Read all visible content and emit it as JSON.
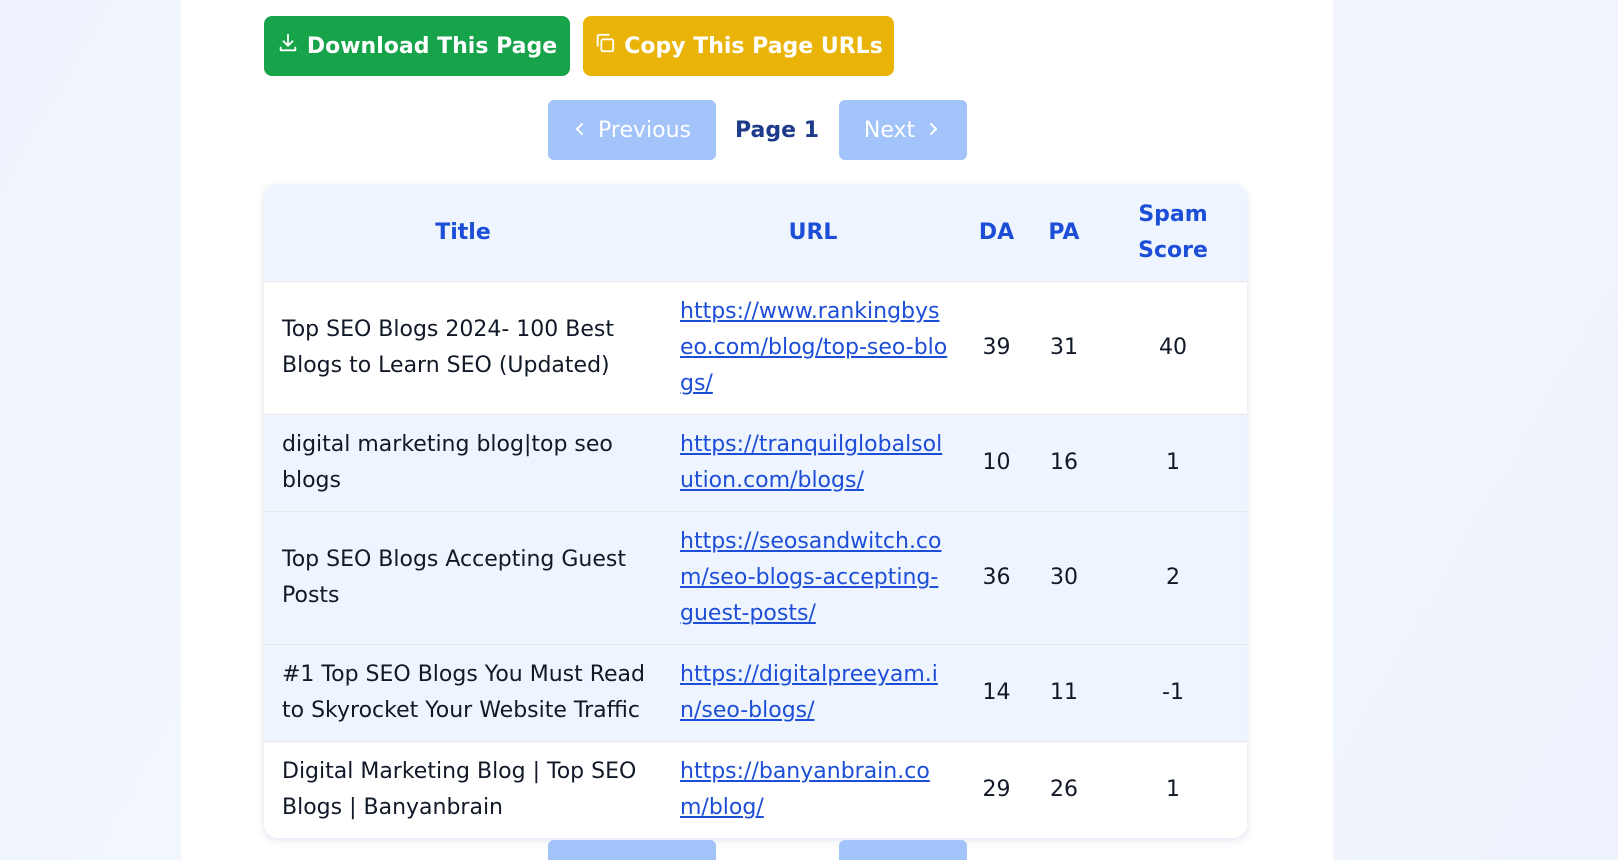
{
  "actions": {
    "download_label": "Download This Page",
    "copy_label": "Copy This Page URLs",
    "download_color": "#16a34a",
    "copy_color": "#eab308"
  },
  "pagination": {
    "previous_label": "Previous",
    "next_label": "Next",
    "page_label": "Page 1"
  },
  "table": {
    "columns": {
      "title": "Title",
      "url": "URL",
      "da": "DA",
      "pa": "PA",
      "spam": "Spam Score"
    },
    "rows": [
      {
        "title": "Top SEO Blogs 2024- 100 Best Blogs to Learn SEO (Updated)",
        "url": "https://www.rankingbyseo.com/blog/top-seo-blogs/",
        "da": "39",
        "pa": "31",
        "spam": "40"
      },
      {
        "title": "digital marketing blog|top seo blogs",
        "url": "https://tranquilglobalsolution.com/blogs/",
        "da": "10",
        "pa": "16",
        "spam": "1"
      },
      {
        "title": "Top SEO Blogs Accepting Guest Posts",
        "url": "https://seosandwitch.com/seo-blogs-accepting-guest-posts/",
        "da": "36",
        "pa": "30",
        "spam": "2"
      },
      {
        "title": "#1 Top SEO Blogs You Must Read to Skyrocket Your Website Traffic",
        "url": "https://digitalpreeyam.in/seo-blogs/",
        "da": "14",
        "pa": "11",
        "spam": "-1"
      },
      {
        "title": "Digital Marketing Blog | Top SEO Blogs | Banyanbrain",
        "url": "https://banyanbrain.com/blog/",
        "da": "29",
        "pa": "26",
        "spam": "1"
      }
    ]
  },
  "colors": {
    "header_text": "#1d4ed8",
    "link": "#1d4ed8",
    "pager_button": "#a3c3fb",
    "page_label": "#1e3a8a"
  }
}
